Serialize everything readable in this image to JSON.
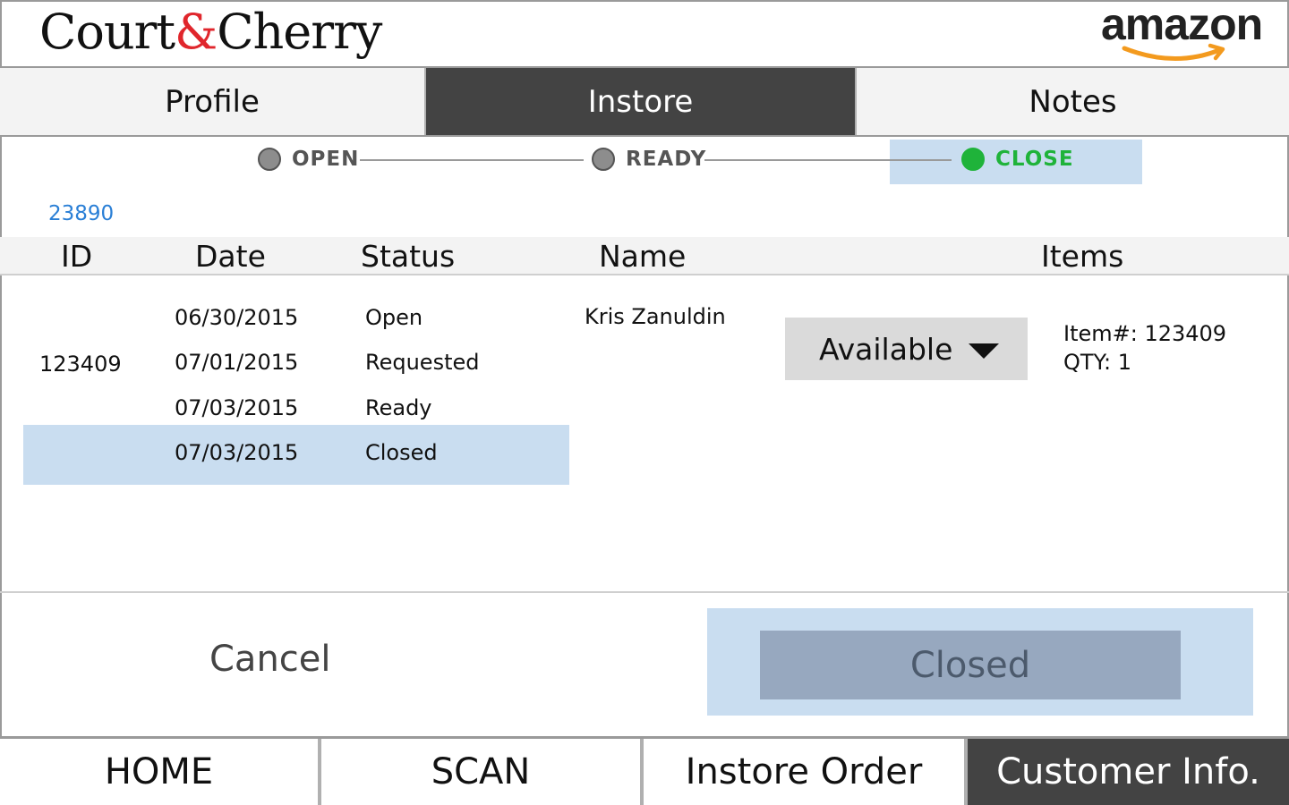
{
  "header": {
    "brand_left": "Court",
    "brand_amp": "&",
    "brand_right": "Cherry",
    "partner": "amazon"
  },
  "tabs": [
    {
      "label": "Profile",
      "active": false
    },
    {
      "label": "Instore",
      "active": true
    },
    {
      "label": "Notes",
      "active": false
    }
  ],
  "progress": {
    "steps": [
      {
        "label": "OPEN",
        "state": "inactive"
      },
      {
        "label": "READY",
        "state": "inactive"
      },
      {
        "label": "CLOSE",
        "state": "current"
      }
    ],
    "colors": {
      "current": "#1fb33a",
      "inactive": "#8d8d8d",
      "highlight": "#c9ddf0"
    }
  },
  "order_number": "23890",
  "table": {
    "headers": {
      "id": "ID",
      "date": "Date",
      "status": "Status",
      "name": "Name",
      "items": "Items"
    },
    "row": {
      "id": "123409",
      "history": [
        {
          "date": "06/30/2015",
          "status": "Open"
        },
        {
          "date": "07/01/2015",
          "status": "Requested"
        },
        {
          "date": "07/03/2015",
          "status": "Ready"
        },
        {
          "date": "07/03/2015",
          "status": "Closed"
        }
      ],
      "name": "Kris Zanuldin",
      "availability": "Available",
      "item_number": "Item#: 123409",
      "qty": "QTY: 1"
    }
  },
  "actions": {
    "cancel": "Cancel",
    "primary": "Closed"
  },
  "bottom_nav": [
    {
      "label": "HOME",
      "active": false
    },
    {
      "label": "SCAN",
      "active": false
    },
    {
      "label": "Instore Order",
      "active": false
    },
    {
      "label": "Customer Info.",
      "active": true
    }
  ]
}
